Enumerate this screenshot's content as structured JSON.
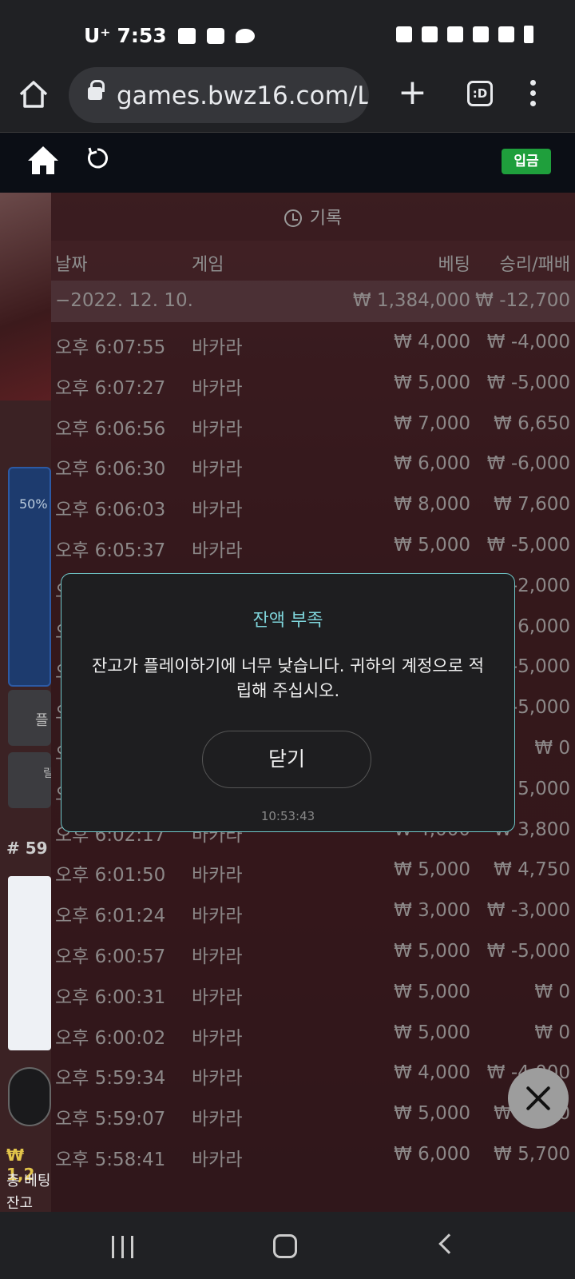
{
  "statusbar": {
    "carrier": "U⁺",
    "time": "7:53"
  },
  "browser": {
    "url": "games.bwz16.com/La",
    "tabs_label": ":D"
  },
  "header": {
    "deposit_label": "입금",
    "accent": "#1f9f3c"
  },
  "left_panel": {
    "percent": "50%",
    "btn1_label": "플",
    "btn2_label": "릴",
    "round_label": "# 59",
    "balance_prefix": "₩ 1,2",
    "total_bet_label": "총 베팅",
    "balance_label": "잔고 ₩"
  },
  "history": {
    "title": "기록",
    "columns": {
      "date": "날짜",
      "game": "게임",
      "bet": "베팅",
      "winloss": "승리/패배"
    },
    "summary": {
      "date": "−2022. 12. 10.",
      "bet": "₩ 1,384,000",
      "winloss": "₩ -12,700"
    },
    "rows": [
      {
        "time": "오후 6:07:55",
        "game": "바카라",
        "bet": "₩ 4,000",
        "winloss": "₩ -4,000"
      },
      {
        "time": "오후 6:07:27",
        "game": "바카라",
        "bet": "₩ 5,000",
        "winloss": "₩ -5,000"
      },
      {
        "time": "오후 6:06:56",
        "game": "바카라",
        "bet": "₩ 7,000",
        "winloss": "₩ 6,650"
      },
      {
        "time": "오후 6:06:30",
        "game": "바카라",
        "bet": "₩ 6,000",
        "winloss": "₩ -6,000"
      },
      {
        "time": "오후 6:06:03",
        "game": "바카라",
        "bet": "₩ 8,000",
        "winloss": "₩ 7,600"
      },
      {
        "time": "오후 6:05:37",
        "game": "바카라",
        "bet": "₩ 5,000",
        "winloss": "₩ -5,000"
      },
      {
        "time": "오",
        "game": "",
        "bet": "",
        "winloss": "-2,000"
      },
      {
        "time": "오",
        "game": "",
        "bet": "",
        "winloss": "6,000"
      },
      {
        "time": "오",
        "game": "",
        "bet": "",
        "winloss": "-5,000"
      },
      {
        "time": "오",
        "game": "",
        "bet": "",
        "winloss": "-5,000"
      },
      {
        "time": "오",
        "game": "",
        "bet": "",
        "winloss": "₩ 0"
      },
      {
        "time": "오",
        "game": "",
        "bet": "",
        "winloss": "5,000"
      },
      {
        "time": "오후 6:02:17",
        "game": "바카라",
        "bet": "₩ 4,000",
        "winloss": "₩ 3,800"
      },
      {
        "time": "오후 6:01:50",
        "game": "바카라",
        "bet": "₩ 5,000",
        "winloss": "₩ 4,750"
      },
      {
        "time": "오후 6:01:24",
        "game": "바카라",
        "bet": "₩ 3,000",
        "winloss": "₩ -3,000"
      },
      {
        "time": "오후 6:00:57",
        "game": "바카라",
        "bet": "₩ 5,000",
        "winloss": "₩ -5,000"
      },
      {
        "time": "오후 6:00:31",
        "game": "바카라",
        "bet": "₩ 5,000",
        "winloss": "₩ 0"
      },
      {
        "time": "오후 6:00:02",
        "game": "바카라",
        "bet": "₩ 5,000",
        "winloss": "₩ 0"
      },
      {
        "time": "오후 5:59:34",
        "game": "바카라",
        "bet": "₩ 4,000",
        "winloss": "₩ -4,000"
      },
      {
        "time": "오후 5:59:07",
        "game": "바카라",
        "bet": "₩ 5,000",
        "winloss": "₩ 4,750"
      },
      {
        "time": "오후 5:58:41",
        "game": "바카라",
        "bet": "₩ 6,000",
        "winloss": "₩ 5,700"
      }
    ]
  },
  "dialog": {
    "title": "잔액 부족",
    "message": "잔고가 플레이하기에 너무 낮습니다. 귀하의 계정으로 적립해 주십시오.",
    "close_label": "닫기",
    "time": "10:53:43",
    "accent": "#6fc7c9"
  }
}
